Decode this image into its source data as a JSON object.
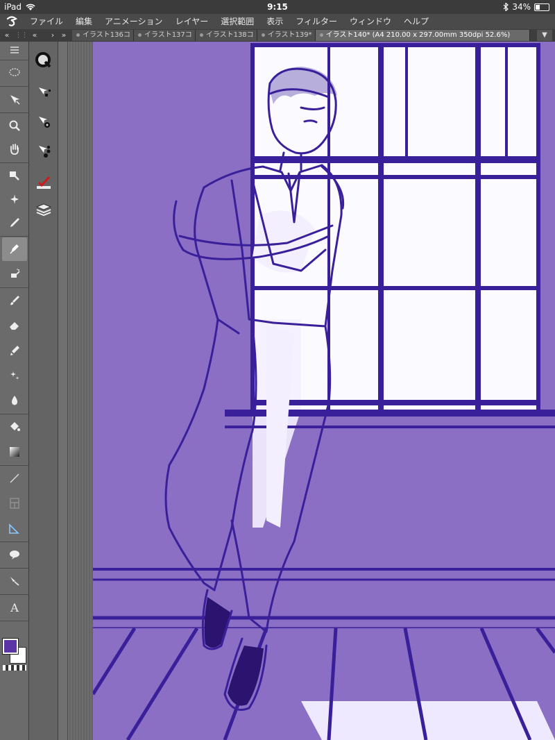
{
  "status_bar": {
    "device": "iPad",
    "time": "9:15",
    "battery": "34%",
    "battery_level": 0.34
  },
  "menu": {
    "items": [
      "ファイル",
      "編集",
      "アニメーション",
      "レイヤー",
      "選択範囲",
      "表示",
      "フィルター",
      "ウィンドウ",
      "ヘルプ"
    ]
  },
  "tabs": {
    "items": [
      {
        "label": "イラスト136コ",
        "active": false
      },
      {
        "label": "イラスト137コ",
        "active": false
      },
      {
        "label": "イラスト138コ",
        "active": false
      },
      {
        "label": "イラスト139*",
        "active": false
      },
      {
        "label": "イラスト140* (A4 210.00 x 297.00mm 350dpi 52.6%)",
        "active": true
      }
    ]
  },
  "colors": {
    "canvas": "#8a6fc4",
    "line": "#3a1f9a",
    "highlight": "#ffffff",
    "main_color": "#5b34a6",
    "sub_color": "#ffffff"
  },
  "tools": [
    "select-lasso-icon",
    "move-icon",
    "zoom-icon",
    "hand-icon",
    "eyedropper-icon",
    "auto-select-icon",
    "pen-icon",
    "pencil-icon",
    "airbrush-icon",
    "brush-icon",
    "eraser-icon",
    "blend-icon",
    "decoration-icon",
    "ink-drop-icon",
    "fill-icon",
    "gradient-icon",
    "line-icon",
    "frame-icon",
    "ruler-icon",
    "balloon-icon",
    "correct-line-icon",
    "text-icon"
  ],
  "subtools": [
    "quick-access-icon",
    "sub-tool-icon",
    "tool-property-icon",
    "brush-size-icon",
    "color-icon",
    "layer-icon"
  ]
}
